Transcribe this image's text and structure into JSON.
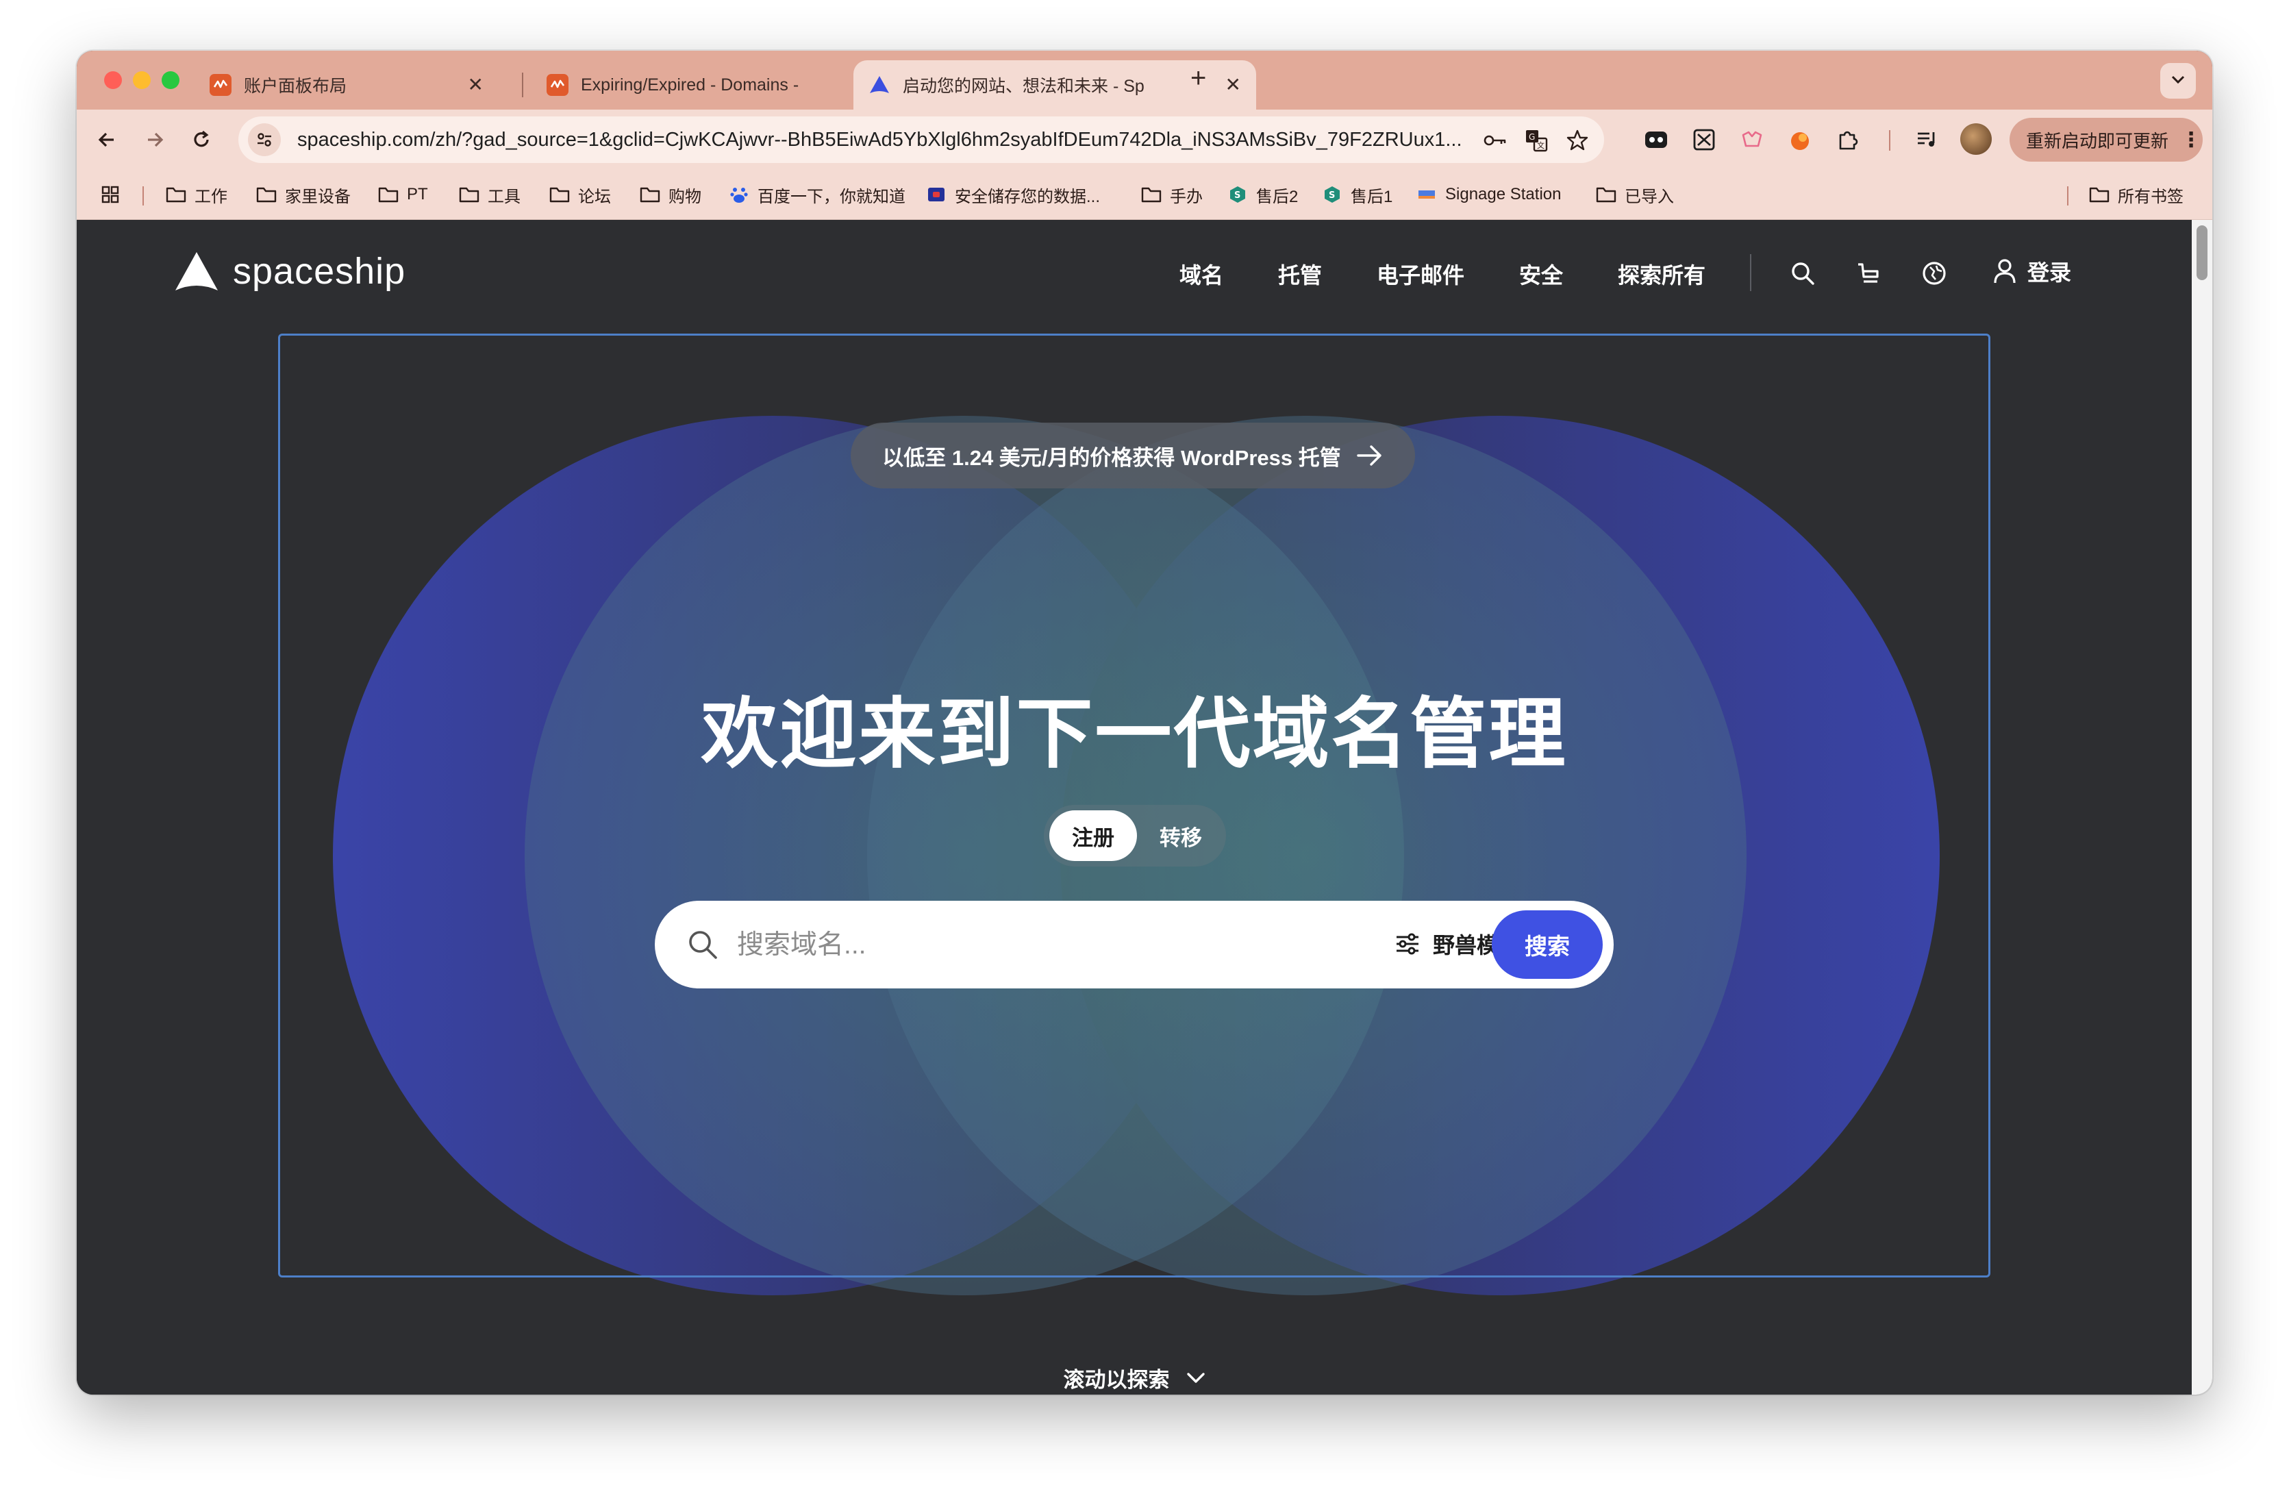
{
  "browser": {
    "tabs": [
      {
        "title": "账户面板布局",
        "active": false
      },
      {
        "title": "Expiring/Expired - Domains -",
        "active": false
      },
      {
        "title": "启动您的网站、想法和未来 - Sp",
        "active": true
      }
    ],
    "new_tab_label": "+",
    "close_glyph": "✕",
    "url": "spaceship.com/zh/?gad_source=1&gclid=CjwKCAjwvr--BhB5EiwAd5YbXlgl6hm2syabIfDEum742Dla_iNS3AMsSiBv_79F2ZRUux1...",
    "update_button": "重新启动即可更新",
    "update_menu": "⋮",
    "bookmarks": [
      {
        "label": "工作",
        "icon": "folder-icon"
      },
      {
        "label": "家里设备",
        "icon": "folder-icon"
      },
      {
        "label": "PT",
        "icon": "folder-icon"
      },
      {
        "label": "工具",
        "icon": "folder-icon"
      },
      {
        "label": "论坛",
        "icon": "folder-icon"
      },
      {
        "label": "购物",
        "icon": "folder-icon"
      },
      {
        "label": "百度一下，你就知道",
        "icon": "baidu-icon"
      },
      {
        "label": "安全储存您的数据...",
        "icon": "shield-icon"
      },
      {
        "label": "手办",
        "icon": "folder-icon"
      },
      {
        "label": "售后2",
        "icon": "s-badge-icon"
      },
      {
        "label": "售后1",
        "icon": "s-badge-icon"
      },
      {
        "label": "Signage Station",
        "icon": "signage-icon"
      },
      {
        "label": "已导入",
        "icon": "folder-icon"
      }
    ],
    "all_bookmarks": "所有书签"
  },
  "site": {
    "brand": "spaceship",
    "nav": [
      "域名",
      "托管",
      "电子邮件",
      "安全",
      "探索所有"
    ],
    "login": "登录",
    "promo": "以低至 1.24 美元/月的价格获得 WordPress 托管",
    "hero_title": "欢迎来到下一代域名管理",
    "toggle": {
      "active": "注册",
      "inactive": "转移"
    },
    "search": {
      "placeholder": "搜索域名...",
      "mode_label": "野兽模式",
      "button": "搜索"
    },
    "scroll_hint": "滚动以探索"
  },
  "colors": {
    "tab_strip": "#e2aa99",
    "toolbar": "#f4dbd3",
    "page_bg": "#2d2e31",
    "accent_blue": "#3f51e3",
    "frame_border": "#4d7fc8"
  }
}
